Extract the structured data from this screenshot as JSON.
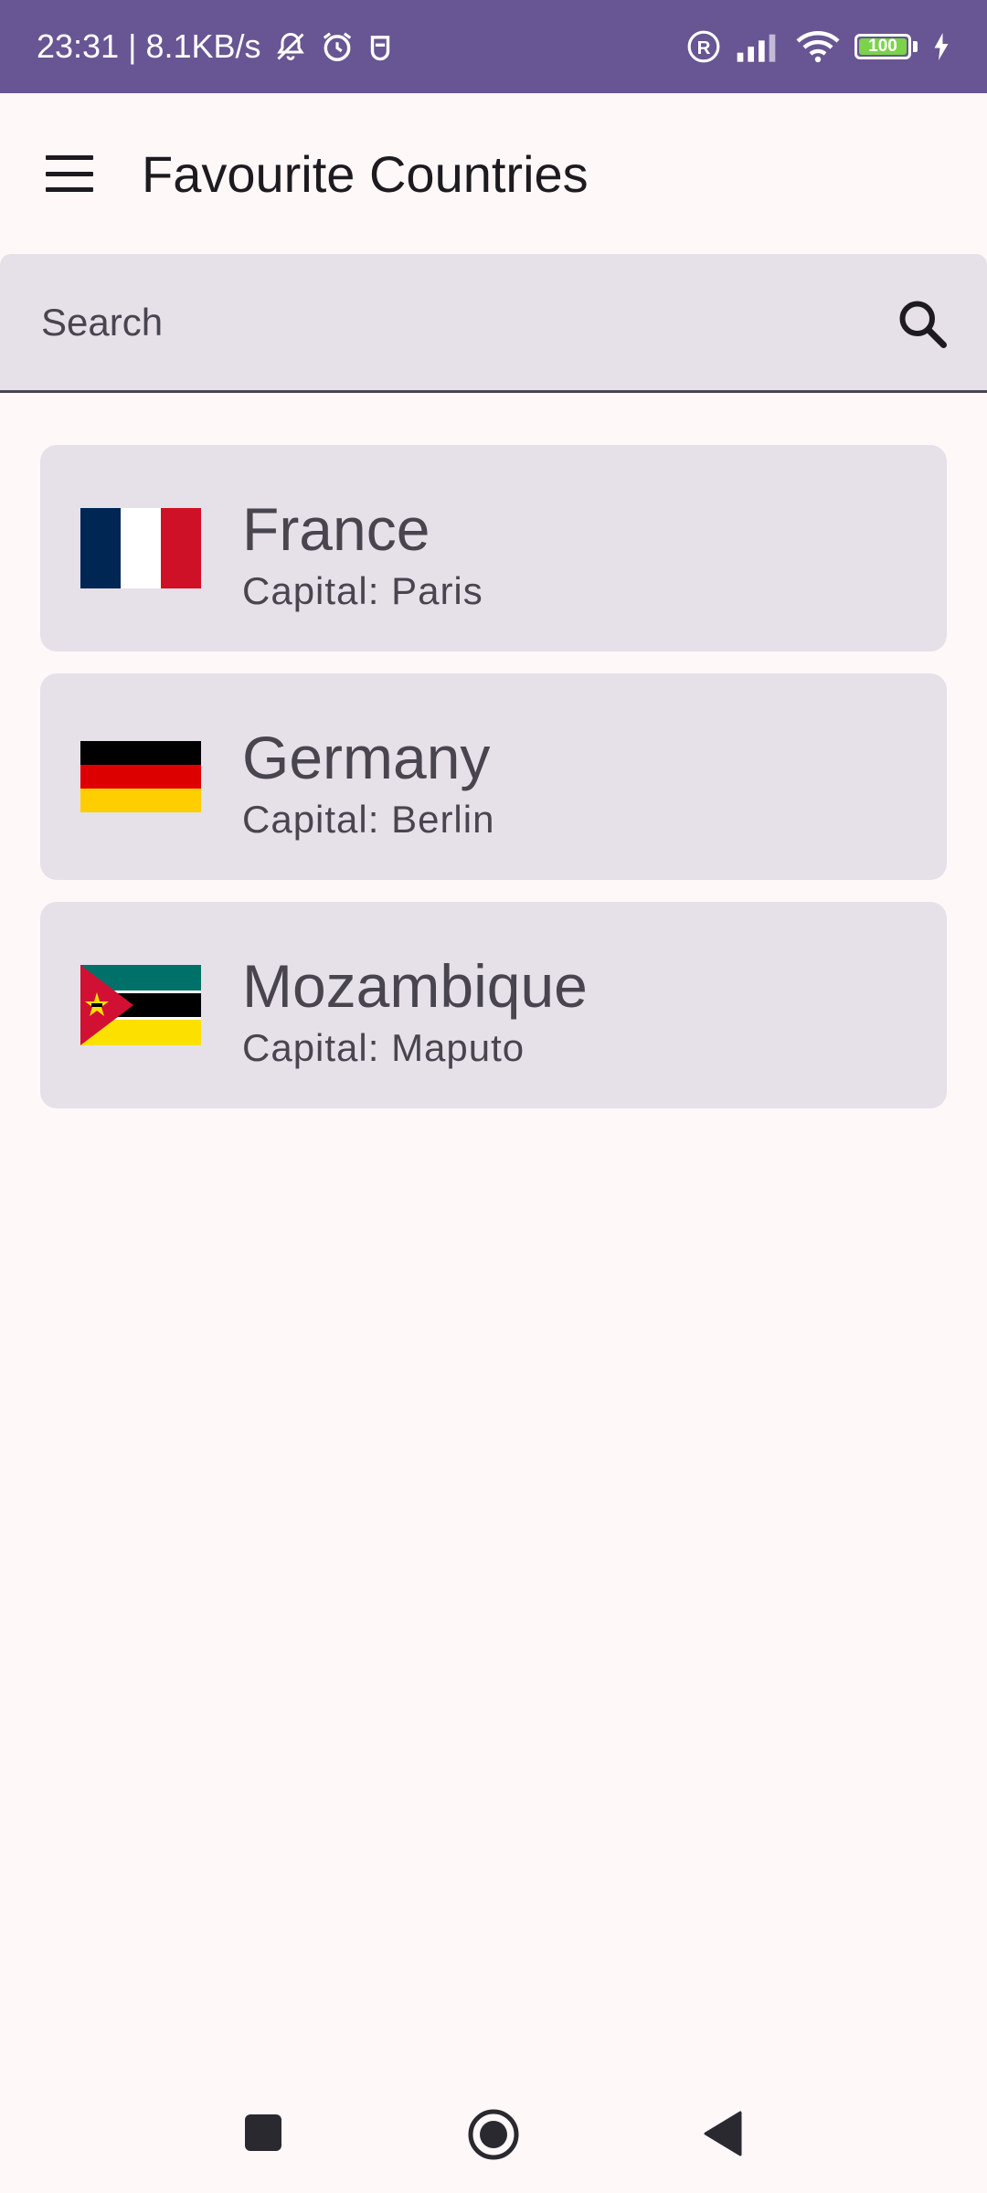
{
  "status_bar": {
    "time_speed": "23:31 | 8.1KB/s",
    "battery_level": "100",
    "icons": [
      "mute-bell-icon",
      "alarm-icon",
      "notification-icon",
      "registered-icon",
      "signal-icon",
      "wifi-icon",
      "battery-icon",
      "charging-icon"
    ],
    "background_color": "#685593"
  },
  "app_bar": {
    "title": "Favourite Countries",
    "menu_icon": "menu-icon"
  },
  "search": {
    "placeholder": "Search",
    "value": "",
    "icon": "search-icon"
  },
  "countries": [
    {
      "name": "France",
      "capital": "Capital: Paris",
      "flag": "france-flag"
    },
    {
      "name": "Germany",
      "capital": "Capital: Berlin",
      "flag": "germany-flag"
    },
    {
      "name": "Mozambique",
      "capital": "Capital: Maputo",
      "flag": "mozambique-flag"
    }
  ],
  "nav_bar": {
    "buttons": [
      "recents-button",
      "home-button",
      "back-button"
    ]
  },
  "colors": {
    "surface": "#fef8f9",
    "card": "#e6e0e9",
    "text_primary": "#1d1b20",
    "text_secondary": "#49454f"
  }
}
